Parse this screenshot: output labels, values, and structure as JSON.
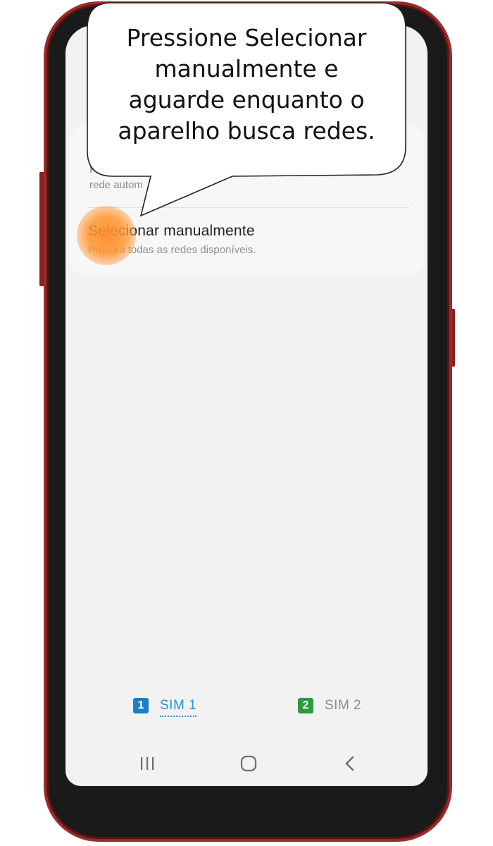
{
  "tutorial": {
    "instruction": "Pressione Selecionar manualmente e aguarde enquanto o aparelho busca redes."
  },
  "network_selection": {
    "auto_option": {
      "description_line1": "Pe",
      "description_line2": "rede autom"
    },
    "manual_option": {
      "title": "Selecionar manualmente",
      "description": "Procura todas as redes disponíveis."
    }
  },
  "sim_tabs": [
    {
      "badge": "1",
      "label": "SIM 1",
      "selected": true,
      "color": "#1a7fc4"
    },
    {
      "badge": "2",
      "label": "SIM 2",
      "selected": false,
      "color": "#2e9a3b"
    }
  ],
  "navigation": {
    "icons": [
      "recents-icon",
      "home-icon",
      "back-icon"
    ]
  },
  "colors": {
    "phone_frame": "#9b2a2a",
    "tap_indicator": "#ff9a3c",
    "accent": "#2b8ed6"
  }
}
